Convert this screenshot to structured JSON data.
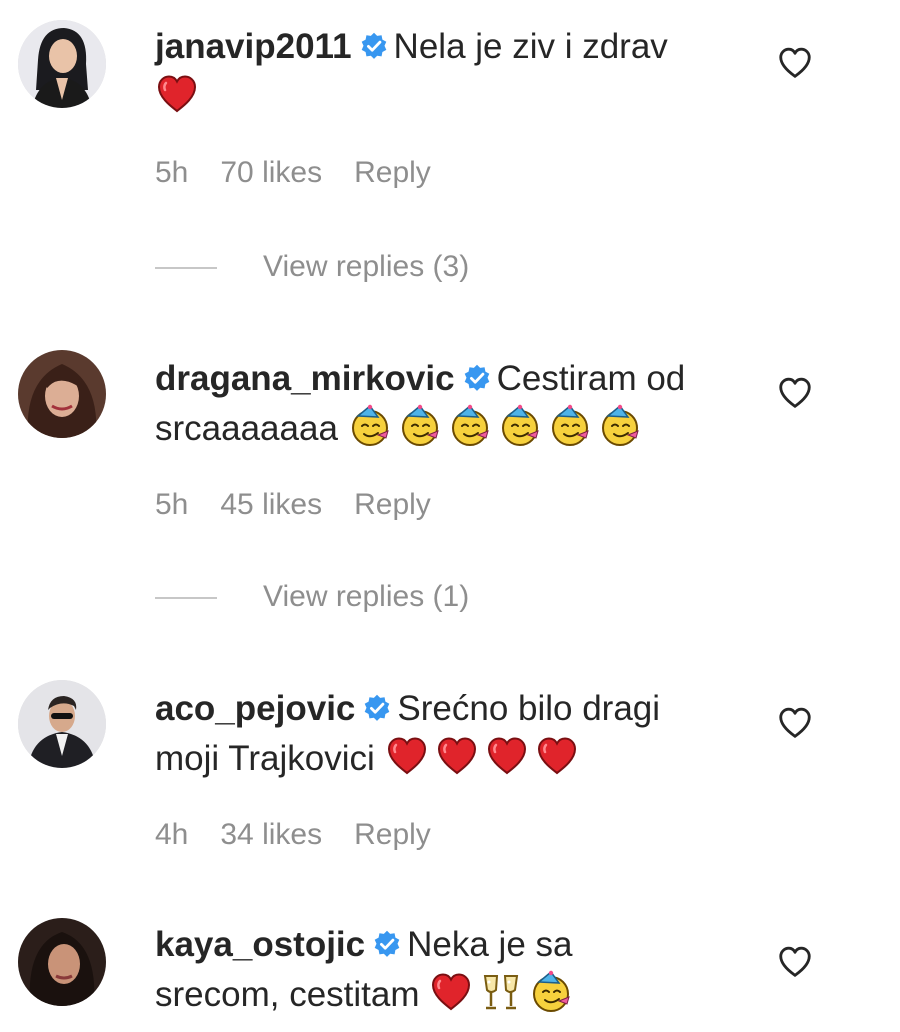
{
  "comments": [
    {
      "username": "janavip2011",
      "text_line1": "Nela je ziv i zdrav",
      "text_line2": "",
      "line2_emojis": [
        "heart"
      ],
      "time": "5h",
      "likes": "70 likes",
      "reply": "Reply",
      "view_replies": "View replies (3)",
      "verified": true
    },
    {
      "username": "dragana_mirkovic",
      "text_line1": "Cestiram od",
      "text_line2": "srcaaaaaaa",
      "line2_emojis": [
        "partying-face",
        "partying-face",
        "partying-face",
        "partying-face",
        "partying-face",
        "partying-face"
      ],
      "time": "5h",
      "likes": "45 likes",
      "reply": "Reply",
      "view_replies": "View replies (1)",
      "verified": true
    },
    {
      "username": "aco_pejovic",
      "text_line1": "Srećno bilo dragi",
      "text_line2": "moji Trajkovici",
      "line2_emojis": [
        "heart",
        "heart",
        "heart",
        "heart"
      ],
      "time": "4h",
      "likes": "34 likes",
      "reply": "Reply",
      "verified": true
    },
    {
      "username": "kaya_ostojic",
      "text_line1": "Neka je sa",
      "text_line2": "srecom, cestitam",
      "line2_emojis": [
        "heart",
        "clinking-glasses",
        "partying-face"
      ],
      "verified": true
    }
  ],
  "colors": {
    "text": "#262626",
    "meta": "#8e8e8e",
    "verified_blue": "#3897f0",
    "heart_red": "#e0242b"
  },
  "icons": {
    "like": "heart-outline-icon",
    "verified": "verified-badge-icon"
  }
}
